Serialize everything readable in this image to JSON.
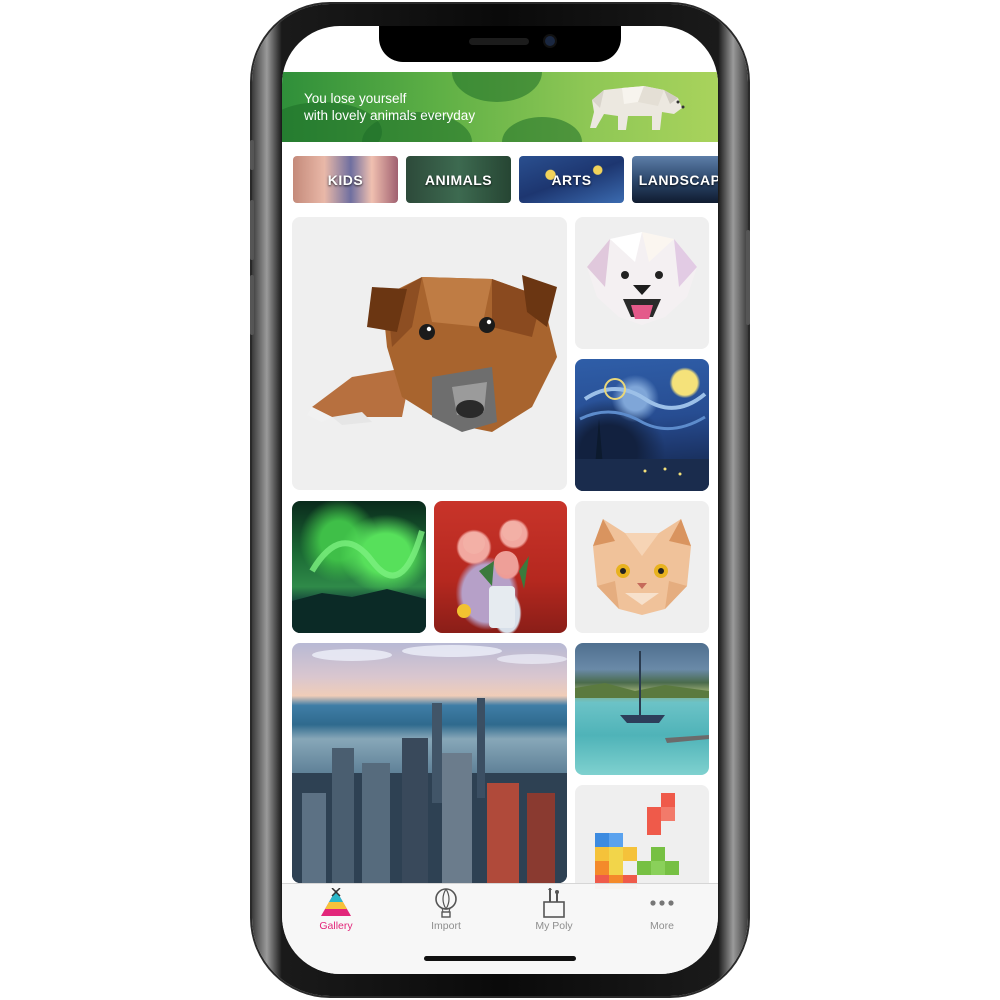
{
  "banner": {
    "line1": "You lose yourself",
    "line2": "with lovely animals everyday"
  },
  "categories": [
    {
      "label": "KIDS"
    },
    {
      "label": "ANIMALS"
    },
    {
      "label": "ARTS"
    },
    {
      "label": "LANDSCAPE"
    }
  ],
  "gallery": [
    {
      "name": "polygon-dog",
      "icon": "dog"
    },
    {
      "name": "polygon-puppy",
      "icon": "puppy"
    },
    {
      "name": "starry-night",
      "icon": "painting"
    },
    {
      "name": "aurora",
      "icon": "landscape"
    },
    {
      "name": "flowers-vase",
      "icon": "painting"
    },
    {
      "name": "polygon-cat",
      "icon": "cat"
    },
    {
      "name": "city-skyline",
      "icon": "landscape"
    },
    {
      "name": "sailboat",
      "icon": "painting"
    },
    {
      "name": "color-blocks",
      "icon": "blocks"
    }
  ],
  "tabbar": {
    "active": "gallery",
    "items": [
      {
        "id": "gallery",
        "label": "Gallery",
        "icon": "teepee-icon"
      },
      {
        "id": "import",
        "label": "Import",
        "icon": "balloon-icon"
      },
      {
        "id": "mypoly",
        "label": "My Poly",
        "icon": "paint-pot-icon"
      },
      {
        "id": "more",
        "label": "More",
        "icon": "more-dots-icon"
      }
    ]
  },
  "colors": {
    "accent": "#e2267a",
    "banner_green": "#5daf45",
    "tab_inactive": "#8e8e8e"
  }
}
